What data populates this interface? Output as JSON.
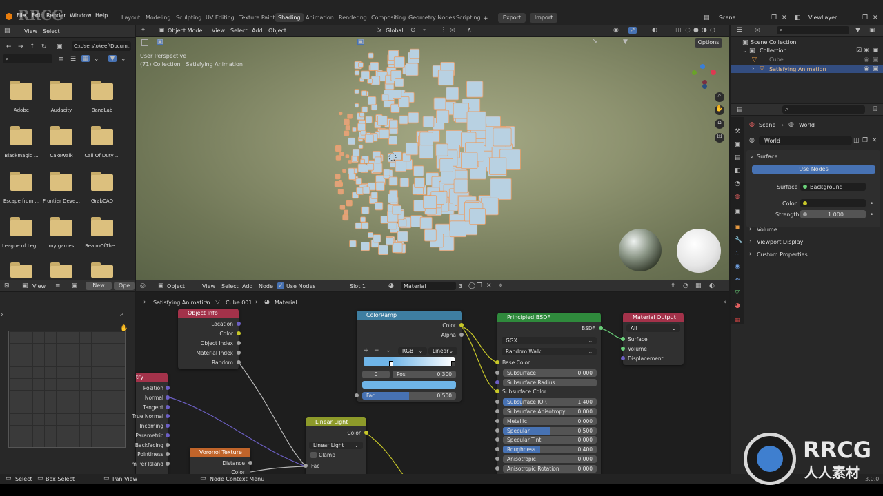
{
  "menus": [
    "File",
    "Edit",
    "Render",
    "Window",
    "Help"
  ],
  "workspace_tabs": [
    "Layout",
    "Modeling",
    "Sculpting",
    "UV Editing",
    "Texture Paint",
    "Shading",
    "Animation",
    "Rendering",
    "Compositing",
    "Geometry Nodes",
    "Scripting"
  ],
  "active_tab": "Shading",
  "top_right": {
    "export": "Export",
    "import": "Import",
    "scene": "Scene",
    "view_layer": "ViewLayer"
  },
  "file_browser": {
    "menu": [
      "View",
      "Select"
    ],
    "path": "C:\\Users\\okeef\\Docum...",
    "folders": [
      "Adobe",
      "Audacity",
      "BandLab",
      "Blackmagic ...",
      "Cakewalk",
      "Call Of Duty ...",
      "Escape from ...",
      "Frontier Deve...",
      "GrabCAD",
      "League of Leg...",
      "my games",
      "RealmOfThe..."
    ]
  },
  "viewport": {
    "mode": "Object Mode",
    "menu": [
      "View",
      "Select",
      "Add",
      "Object"
    ],
    "transform": "Global",
    "options": "Options",
    "perspective": "User Perspective",
    "collection_info": "(71) Collection | Satisfying Animation"
  },
  "outliner": {
    "root": "Scene Collection",
    "collection": "Collection",
    "items": [
      "Cube",
      "Satisfying Animation"
    ]
  },
  "properties": {
    "breadcrumb_scene": "Scene",
    "breadcrumb_world": "World",
    "world_name": "World",
    "surface_panel": "Surface",
    "use_nodes": "Use Nodes",
    "surface_label": "Surface",
    "surface_value": "Background",
    "color_label": "Color",
    "strength_label": "Strength",
    "strength_value": "1.000",
    "volume": "Volume",
    "viewport_display": "Viewport Display",
    "custom_properties": "Custom Properties"
  },
  "image_editor": {
    "view": "View",
    "new": "New",
    "open": "Ope"
  },
  "node_editor": {
    "type": "Object",
    "menu": [
      "View",
      "Select",
      "Add",
      "Node"
    ],
    "use_nodes": "Use Nodes",
    "slot": "Slot 1",
    "material": "Material",
    "users": "3",
    "breadcrumb": [
      "Satisfying Animation",
      "Cube.001",
      "Material"
    ]
  },
  "nodes": {
    "object_info": {
      "title": "Object Info",
      "outputs": [
        "Location",
        "Color",
        "Object Index",
        "Material Index",
        "Random"
      ]
    },
    "geometry": {
      "title": "try",
      "outputs": [
        "Position",
        "Normal",
        "Tangent",
        "True Normal",
        "Incoming",
        "Parametric",
        "Backfacing",
        "Pointiness",
        "m Per Island"
      ]
    },
    "voronoi": {
      "title": "Voronoi Texture",
      "outputs": [
        "Distance",
        "Color"
      ]
    },
    "linear_light": {
      "title": "Linear Light",
      "output": "Color",
      "blend": "Linear Light",
      "clamp": "Clamp",
      "input": "Fac"
    },
    "color_ramp": {
      "title": "ColorRamp",
      "outputs": [
        "Color",
        "Alpha"
      ],
      "color_mode": "RGB",
      "interpolation": "Linear",
      "index": "0",
      "pos_label": "Pos",
      "pos_value": "0.300",
      "fac_label": "Fac",
      "fac_value": "0.500",
      "fac": 0.5
    },
    "principled": {
      "title": "Principled BSDF",
      "output": "BSDF",
      "distribution": "GGX",
      "subsurface_method": "Random Walk",
      "base_color": "Base Color",
      "subsurface_color": "Subsurface Color",
      "fields": [
        {
          "label": "Subsurface",
          "value": "0.000",
          "fill": 0
        },
        {
          "label": "Subsurface Radius",
          "value": "",
          "fill": 0
        },
        {
          "label": "Subsurface IOR",
          "value": "1.400",
          "fill": 0.2
        },
        {
          "label": "Subsurface Anisotropy",
          "value": "0.000",
          "fill": 0
        },
        {
          "label": "Metallic",
          "value": "0.000",
          "fill": 0
        },
        {
          "label": "Specular",
          "value": "0.500",
          "fill": 0.5
        },
        {
          "label": "Specular Tint",
          "value": "0.000",
          "fill": 0
        },
        {
          "label": "Roughness",
          "value": "0.400",
          "fill": 0.4
        },
        {
          "label": "Anisotropic",
          "value": "0.000",
          "fill": 0
        },
        {
          "label": "Anisotropic Rotation",
          "value": "0.000",
          "fill": 0
        }
      ]
    },
    "material_output": {
      "title": "Material Output",
      "target": "All",
      "inputs": [
        "Surface",
        "Volume",
        "Displacement"
      ]
    }
  },
  "status_bar": {
    "select": "Select",
    "box_select": "Box Select",
    "pan_view": "Pan View",
    "node_context": "Node Context Menu",
    "version": "3.0.0"
  },
  "watermark": {
    "brand": "RRCG",
    "sub": "人人素材"
  }
}
